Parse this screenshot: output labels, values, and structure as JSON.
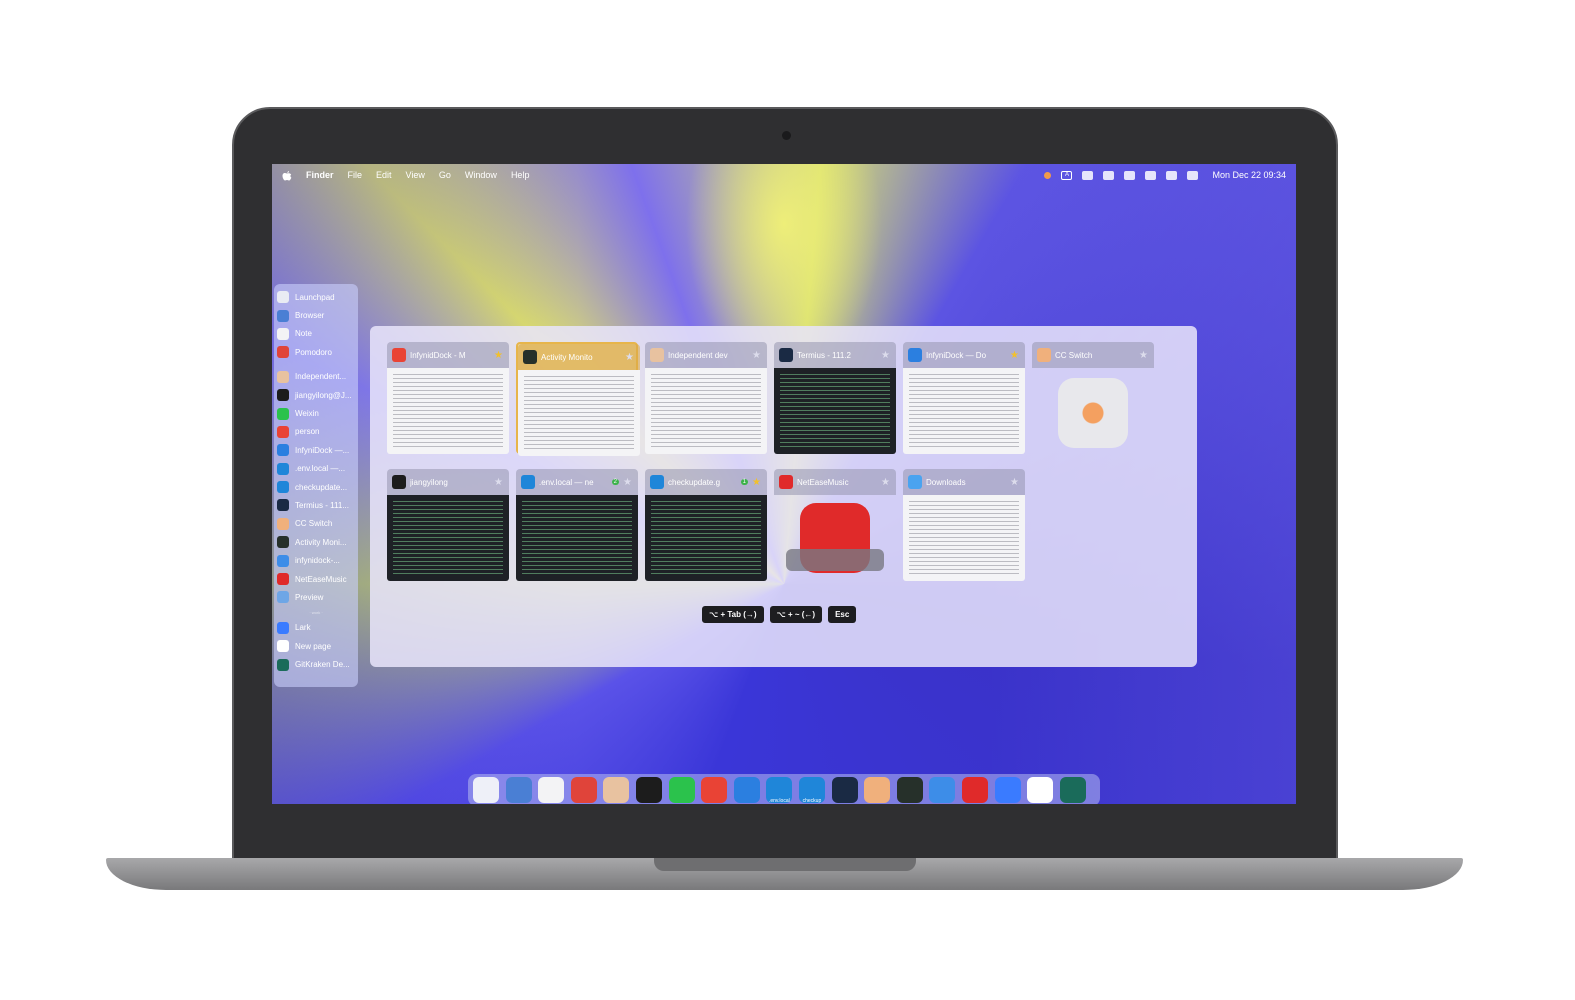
{
  "menubar": {
    "app": "Finder",
    "menus": [
      "File",
      "Edit",
      "View",
      "Go",
      "Window",
      "Help"
    ],
    "input_indicator": "A",
    "clock": "Mon Dec 22  09:34"
  },
  "sidebar": {
    "items": [
      {
        "label": "Launchpad",
        "color": "#e9ebf3"
      },
      {
        "label": "Browser",
        "color": "#4a7fd4"
      },
      {
        "label": "Note",
        "color": "#f3f3f5"
      },
      {
        "label": "Pomodoro",
        "color": "#e0443a"
      },
      {
        "label": "Independent...",
        "color": "#e8c2a0"
      },
      {
        "label": "jiangyilong@J...",
        "color": "#1c1c1c"
      },
      {
        "label": "Weixin",
        "color": "#2bc24c"
      },
      {
        "label": "person",
        "color": "#e94335"
      },
      {
        "label": "InfyniDock —...",
        "color": "#2b7fe0"
      },
      {
        "label": ".env.local —...",
        "color": "#1f86d9"
      },
      {
        "label": "checkupdate...",
        "color": "#1f86d9"
      },
      {
        "label": "Termius - 111...",
        "color": "#1a2a44"
      },
      {
        "label": "CC Switch",
        "color": "#f0b07c"
      },
      {
        "label": "Activity Moni...",
        "color": "#26302a"
      },
      {
        "label": "infynidock-...",
        "color": "#3d8de8"
      },
      {
        "label": "NetEaseMusic",
        "color": "#e02a2a"
      },
      {
        "label": "Preview",
        "color": "#6ea6e6"
      },
      {
        "label": "Lark",
        "color": "#3a7bff"
      },
      {
        "label": "New page",
        "color": "#ffffff"
      },
      {
        "label": "GitKraken De...",
        "color": "#1a6b5a"
      }
    ],
    "divider": "· work ·"
  },
  "switcher": {
    "cards": [
      {
        "title": "InfynidDock - M",
        "icon_color": "#e94335",
        "starred": true,
        "thumb": "light",
        "badge": ""
      },
      {
        "title": "Activity Monito",
        "icon_color": "#26302a",
        "starred": false,
        "thumb": "light",
        "badge": "",
        "selected": true
      },
      {
        "title": "Independent dev",
        "icon_color": "#e8c2a0",
        "starred": false,
        "thumb": "light",
        "badge": ""
      },
      {
        "title": "Termius - 111.2",
        "icon_color": "#1a2a44",
        "starred": false,
        "thumb": "dark",
        "badge": ""
      },
      {
        "title": "InfyniDock — Do",
        "icon_color": "#2b7fe0",
        "starred": true,
        "thumb": "light",
        "badge": ""
      },
      {
        "title": "CC Switch",
        "icon_color": "#f0b07c",
        "starred": false,
        "thumb": "app",
        "badge": ""
      },
      {
        "title": "jiangyilong",
        "icon_color": "#1c1c1c",
        "starred": false,
        "thumb": "dark",
        "badge": ""
      },
      {
        "title": ".env.local — ne",
        "icon_color": "#1f86d9",
        "starred": false,
        "thumb": "dark",
        "badge": "2"
      },
      {
        "title": "checkupdate.g",
        "icon_color": "#1f86d9",
        "starred": true,
        "thumb": "dark",
        "badge": "1"
      },
      {
        "title": "NetEaseMusic",
        "icon_color": "#e02a2a",
        "starred": false,
        "thumb": "music",
        "badge": ""
      },
      {
        "title": "Downloads",
        "icon_color": "#4aa3f0",
        "starred": false,
        "thumb": "light",
        "badge": ""
      }
    ],
    "hints": [
      "⌥ + Tab (→)",
      "⌥ + ~ (←)",
      "Esc"
    ]
  },
  "dock": {
    "items": [
      {
        "name": "launchpad",
        "color": "#eef0f8",
        "tag": ""
      },
      {
        "name": "browser",
        "color": "#4a7fd4",
        "tag": ""
      },
      {
        "name": "note",
        "color": "#f3f3f5",
        "tag": ""
      },
      {
        "name": "pomodoro",
        "color": "#e0443a",
        "tag": ""
      },
      {
        "name": "independent",
        "color": "#e8c2a0",
        "tag": ""
      },
      {
        "name": "terminal",
        "color": "#1c1c1c",
        "tag": ""
      },
      {
        "name": "weixin",
        "color": "#2bc24c",
        "tag": ""
      },
      {
        "name": "chrome",
        "color": "#e94335",
        "tag": ""
      },
      {
        "name": "xcode",
        "color": "#2b7fe0",
        "tag": ""
      },
      {
        "name": "vscode-env",
        "color": "#1f86d9",
        "tag": ".env.local"
      },
      {
        "name": "vscode-checkup",
        "color": "#1f86d9",
        "tag": "checkup"
      },
      {
        "name": "termius",
        "color": "#1a2a44",
        "tag": ""
      },
      {
        "name": "cc-switch",
        "color": "#f0b07c",
        "tag": ""
      },
      {
        "name": "activity-monitor",
        "color": "#26302a",
        "tag": ""
      },
      {
        "name": "finder",
        "color": "#3d8de8",
        "tag": ""
      },
      {
        "name": "netease-music",
        "color": "#e02a2a",
        "tag": ""
      },
      {
        "name": "lark",
        "color": "#3a7bff",
        "tag": ""
      },
      {
        "name": "notion",
        "color": "#ffffff",
        "tag": ""
      },
      {
        "name": "gitkraken",
        "color": "#1a6b5a",
        "tag": ""
      }
    ]
  }
}
